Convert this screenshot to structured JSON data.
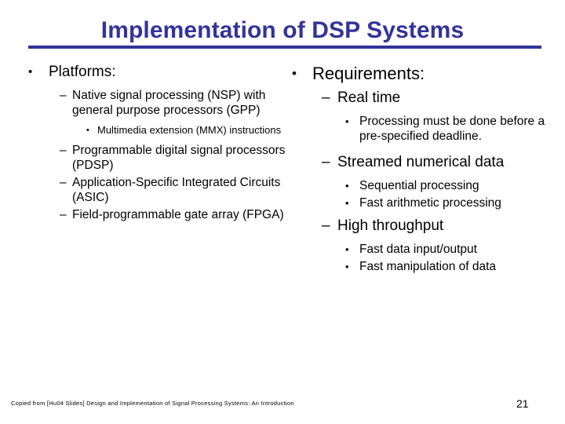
{
  "slide": {
    "title": "Implementation of DSP Systems",
    "title_color": "#333399",
    "background_color": "#ffffff",
    "text_color": "#000000",
    "page_number": "21",
    "footer": "Copied from  [Hu04 Slides] Design and Implementation of Signal Processing Systems: An Introduction"
  },
  "markers": {
    "level1": "•",
    "level2": "–",
    "level3": "•"
  },
  "left_column": {
    "heading": "Platforms:",
    "items": [
      {
        "level": 2,
        "text": "Native signal processing (NSP) with general purpose processors (GPP)"
      },
      {
        "level": 3,
        "text": "Multimedia extension (MMX) instructions"
      },
      {
        "level": 2,
        "text": "Programmable digital signal processors (PDSP)"
      },
      {
        "level": 2,
        "text": "Application-Specific Integrated Circuits (ASIC)"
      },
      {
        "level": 2,
        "text": "Field-programmable gate array (FPGA)"
      }
    ]
  },
  "right_column": {
    "heading": "Requirements:",
    "items": [
      {
        "level": 2,
        "text": "Real time"
      },
      {
        "level": 3,
        "text": "Processing must be done before a pre-specified deadline."
      },
      {
        "level": 2,
        "text": "Streamed numerical data"
      },
      {
        "level": 3,
        "text": "Sequential processing"
      },
      {
        "level": 3,
        "text": "Fast arithmetic processing"
      },
      {
        "level": 2,
        "text": "High throughput"
      },
      {
        "level": 3,
        "text": "Fast data input/output"
      },
      {
        "level": 3,
        "text": "Fast manipulation of data"
      }
    ]
  }
}
